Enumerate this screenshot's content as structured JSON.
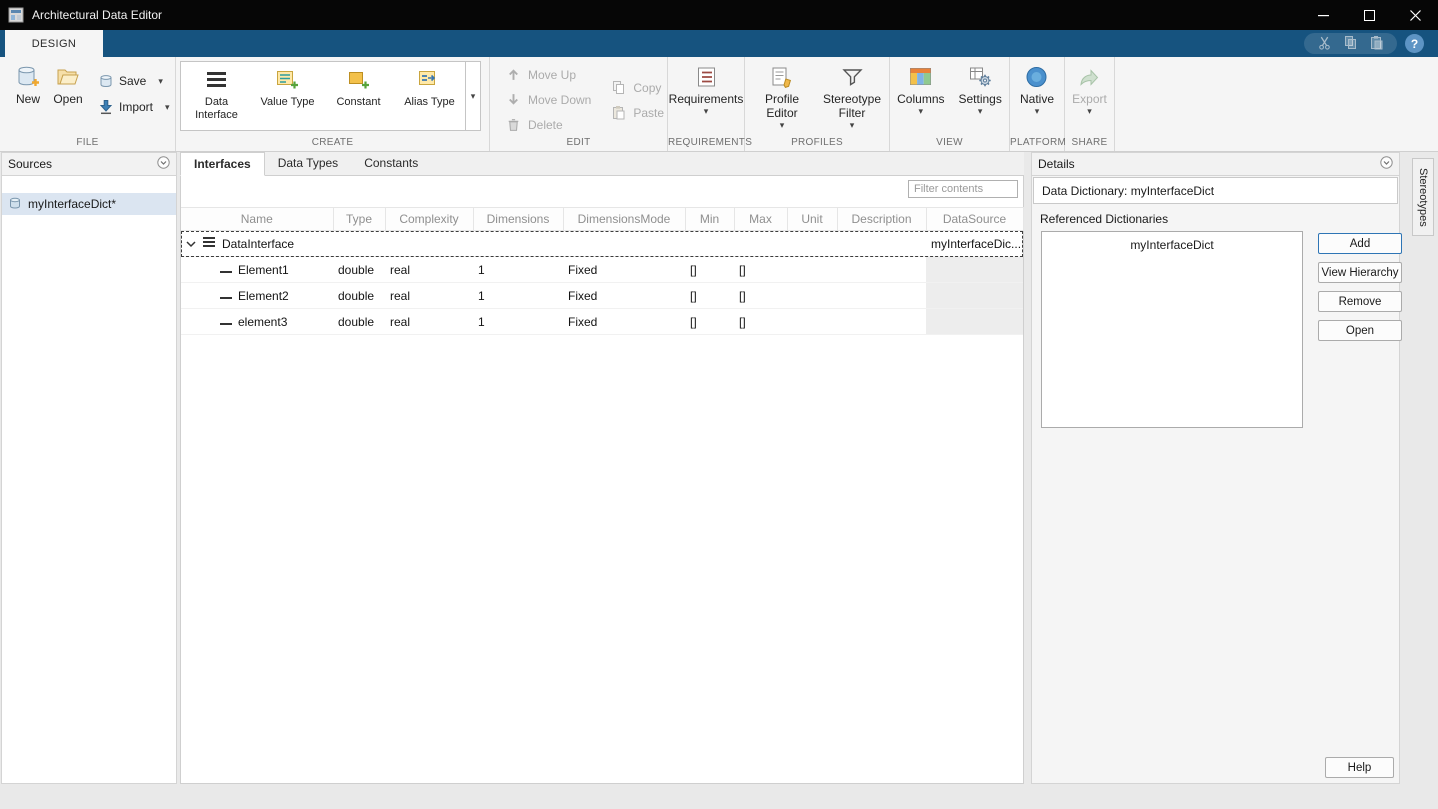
{
  "titlebar": {
    "title": "Architectural Data Editor"
  },
  "ribbon": {
    "design_tab": "DESIGN"
  },
  "icons": {
    "dropdown": "▾",
    "help": "?"
  },
  "toolbar": {
    "file": {
      "label": "FILE",
      "new": "New",
      "open": "Open",
      "save": "Save",
      "import": "Import"
    },
    "create": {
      "label": "CREATE",
      "data_interface": "Data Interface",
      "value_type": "Value Type",
      "constant": "Constant",
      "alias_type": "Alias Type"
    },
    "edit": {
      "label": "EDIT",
      "move_up": "Move Up",
      "move_down": "Move Down",
      "delete": "Delete",
      "copy": "Copy",
      "paste": "Paste"
    },
    "requirements": {
      "label": "REQUIREMENTS",
      "requirements": "Requirements"
    },
    "profiles": {
      "label": "PROFILES",
      "profile_editor": "Profile Editor",
      "stereotype_filter": "Stereotype Filter"
    },
    "view": {
      "label": "VIEW",
      "columns": "Columns",
      "settings": "Settings"
    },
    "platform": {
      "label": "PLATFORM",
      "native": "Native"
    },
    "share": {
      "label": "SHARE",
      "export": "Export"
    }
  },
  "sources": {
    "title": "Sources",
    "items": [
      {
        "label": "myInterfaceDict*"
      }
    ]
  },
  "main": {
    "tabs": [
      {
        "label": "Interfaces"
      },
      {
        "label": "Data Types"
      },
      {
        "label": "Constants"
      }
    ],
    "filter_placeholder": "Filter contents",
    "table": {
      "columns": [
        "Name",
        "Type",
        "Complexity",
        "Dimensions",
        "DimensionsMode",
        "Min",
        "Max",
        "Unit",
        "Description",
        "DataSource"
      ],
      "rows": [
        {
          "name": "DataInterface",
          "type": "",
          "complexity": "",
          "dimensions": "",
          "dimensions_mode": "",
          "min": "",
          "max": "",
          "unit": "",
          "description": "",
          "data_source": "myInterfaceDic..."
        },
        {
          "name": "Element1",
          "type": "double",
          "complexity": "real",
          "dimensions": "1",
          "dimensions_mode": "Fixed",
          "min": "[]",
          "max": "[]",
          "unit": "",
          "description": "",
          "data_source": ""
        },
        {
          "name": "Element2",
          "type": "double",
          "complexity": "real",
          "dimensions": "1",
          "dimensions_mode": "Fixed",
          "min": "[]",
          "max": "[]",
          "unit": "",
          "description": "",
          "data_source": ""
        },
        {
          "name": "element3",
          "type": "double",
          "complexity": "real",
          "dimensions": "1",
          "dimensions_mode": "Fixed",
          "min": "[]",
          "max": "[]",
          "unit": "",
          "description": "",
          "data_source": ""
        }
      ]
    }
  },
  "details": {
    "title": "Details",
    "data_dictionary": "Data Dictionary: myInterfaceDict",
    "referenced_dictionaries_label": "Referenced Dictionaries",
    "referenced_list": [
      {
        "label": "myInterfaceDict"
      }
    ],
    "buttons": {
      "add": "Add",
      "view_hierarchy": "View Hierarchy",
      "remove": "Remove",
      "open": "Open"
    },
    "help": "Help"
  },
  "right_strip": {
    "stereotypes_tab": "Stereotypes"
  }
}
